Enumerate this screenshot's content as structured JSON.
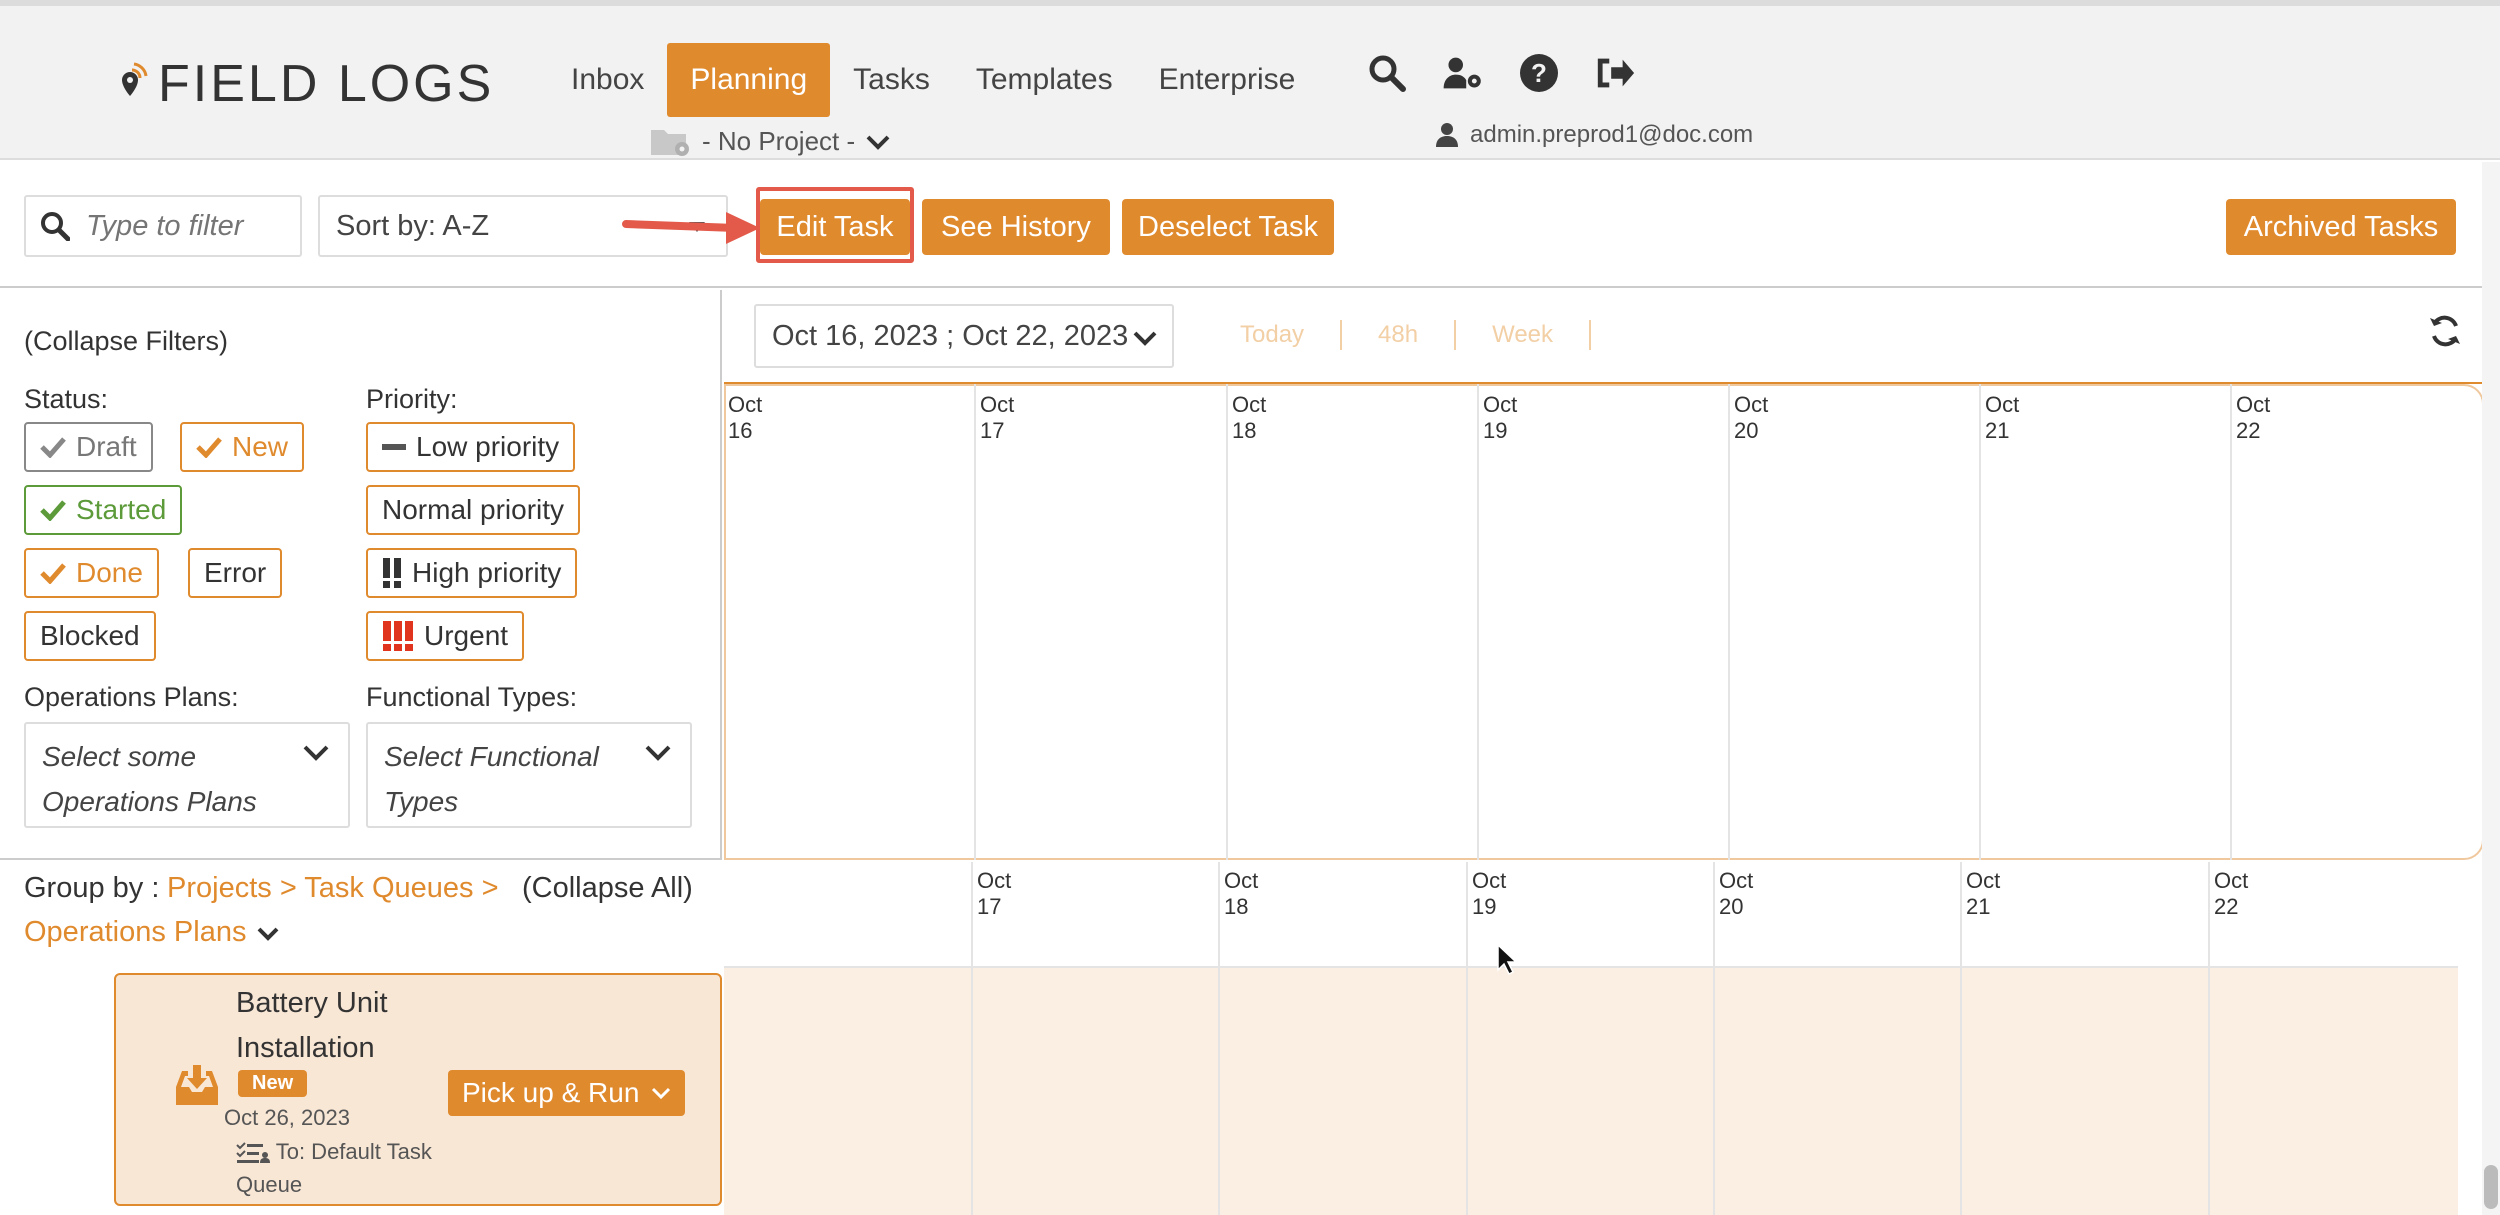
{
  "header": {
    "logo_text": "FIELD LOGS",
    "nav": [
      {
        "label": "Inbox",
        "active": false
      },
      {
        "label": "Planning",
        "active": true
      },
      {
        "label": "Tasks",
        "active": false
      },
      {
        "label": "Templates",
        "active": false
      },
      {
        "label": "Enterprise",
        "active": false
      }
    ],
    "icons": [
      "search-icon",
      "user-settings-icon",
      "help-icon",
      "logout-icon"
    ],
    "project_selector": "- No Project -",
    "user_email": "admin.preprod1@doc.com"
  },
  "toolbar": {
    "filter_placeholder": "Type to filter",
    "sort_label": "Sort by: A-Z",
    "edit_task": "Edit Task",
    "see_history": "See History",
    "deselect_task": "Deselect Task",
    "archived_tasks": "Archived Tasks"
  },
  "filters": {
    "collapse": "(Collapse Filters)",
    "status_label": "Status:",
    "status": [
      "Draft",
      "New",
      "Started",
      "Done",
      "Error",
      "Blocked"
    ],
    "priority_label": "Priority:",
    "priority": [
      "Low priority",
      "Normal priority",
      "High priority",
      "Urgent"
    ],
    "ops_plans_label": "Operations Plans:",
    "ops_plans_placeholder": "Select some Operations Plans",
    "func_types_label": "Functional Types:",
    "func_types_placeholder": "Select Functional Types"
  },
  "calendar": {
    "range": "Oct 16, 2023 ; Oct 22, 2023",
    "range_options": [
      "Today",
      "48h",
      "Week"
    ],
    "days_top": [
      "Oct 16",
      "Oct 17",
      "Oct 18",
      "Oct 19",
      "Oct 20",
      "Oct 21",
      "Oct 22"
    ],
    "days_bottom": [
      "Oct 17",
      "Oct 18",
      "Oct 19",
      "Oct 20",
      "Oct 21",
      "Oct 22"
    ]
  },
  "group": {
    "group_by": "Group by :",
    "path": "Projects > Task Queues >",
    "path2": "Operations Plans",
    "collapse_all": "(Collapse All)"
  },
  "task": {
    "title": "Battery Unit Installation",
    "badge": "New",
    "date": "Oct 26, 2023",
    "queue": "To: Default Task Queue",
    "action": "Pick up & Run"
  },
  "colors": {
    "accent": "#e08a2e",
    "green": "#5c9a3a",
    "urgent": "#e0341f",
    "highlight": "#e35a4a"
  }
}
